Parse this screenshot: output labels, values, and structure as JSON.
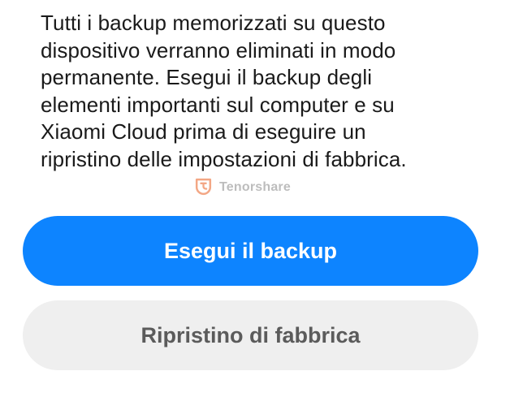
{
  "message": {
    "lines": [
      "Tutti i backup memorizzati su questo",
      "dispositivo verranno eliminati in modo",
      "permanente. Esegui il backup degli",
      "elementi importanti sul computer e su",
      "Xiaomi Cloud prima di eseguire un",
      "ripristino delle impostazioni di fabbrica."
    ]
  },
  "watermark": {
    "logo_icon": "tenorshare-logo-icon",
    "text": "Tenorshare",
    "color": "#f08a5d"
  },
  "buttons": {
    "backup_label": "Esegui il backup",
    "reset_label": "Ripristino di fabbrica"
  },
  "colors": {
    "primary": "#0d84ff",
    "secondary_bg": "#efefef",
    "secondary_text": "#5b5b5b"
  }
}
